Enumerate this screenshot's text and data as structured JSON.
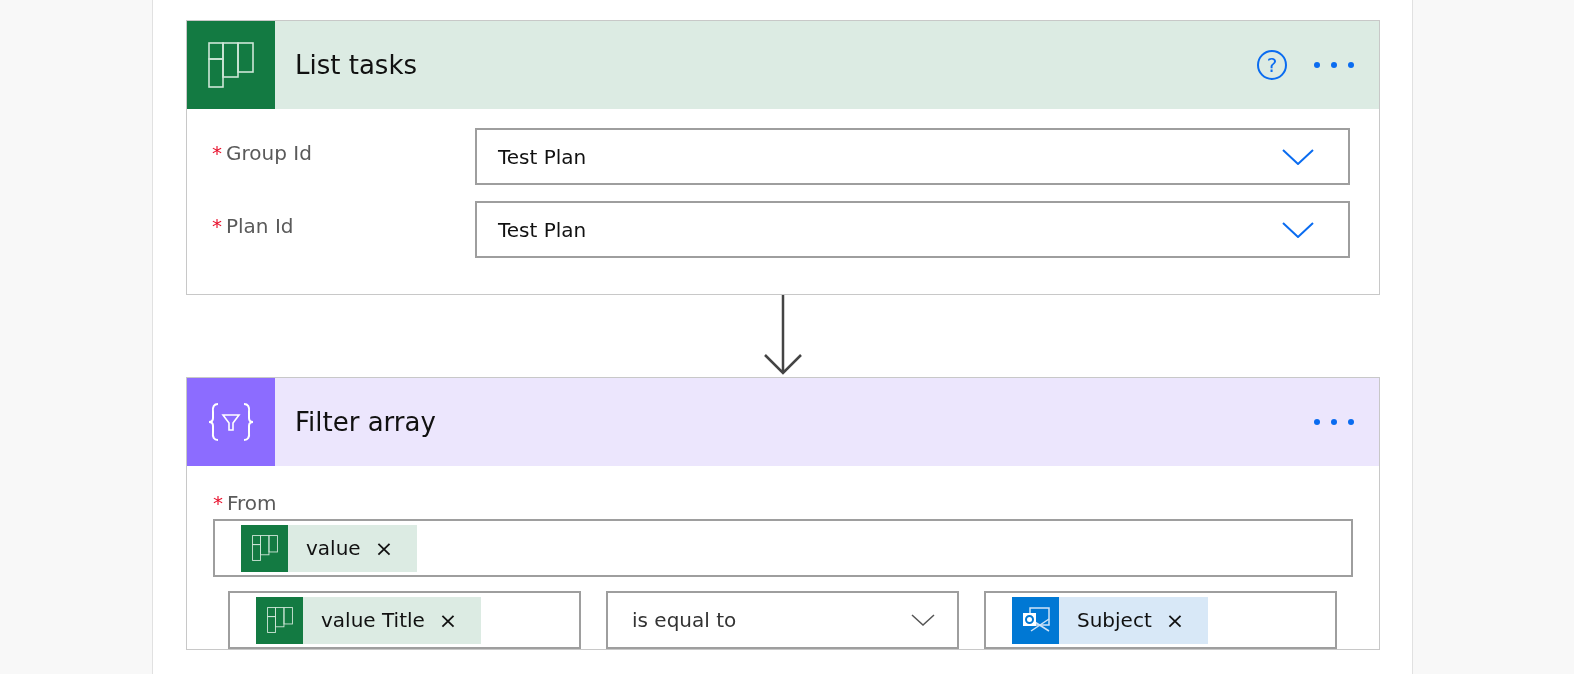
{
  "cards": [
    {
      "title": "List tasks",
      "kind": "planner",
      "help": "?",
      "fields": [
        {
          "label": "Group Id",
          "required_mark": "*",
          "value": "Test Plan"
        },
        {
          "label": "Plan Id",
          "required_mark": "*",
          "value": "Test Plan"
        }
      ]
    },
    {
      "title": "Filter array",
      "kind": "filter",
      "from": {
        "label": "From",
        "required_mark": "*",
        "tokens": [
          {
            "kind": "planner",
            "label": "value",
            "remove": "×"
          }
        ]
      },
      "condition": {
        "left": [
          {
            "kind": "planner",
            "label": "value Title",
            "remove": "×"
          }
        ],
        "operator": "is equal to",
        "right": [
          {
            "kind": "outlook",
            "label": "Subject",
            "remove": "×"
          }
        ]
      }
    }
  ]
}
